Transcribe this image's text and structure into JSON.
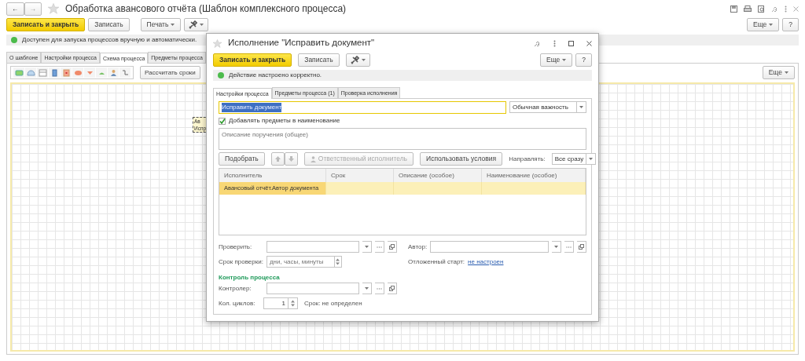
{
  "window": {
    "back": "←",
    "forward": "→",
    "title": "Обработка авансового отчёта (Шаблон комплексного процесса)",
    "buttons": [
      {
        "kind": "primary",
        "label": "Записать и закрыть"
      },
      {
        "kind": "plain",
        "label": "Записать"
      },
      {
        "kind": "menu",
        "label": "Печать"
      },
      {
        "kind": "tools"
      }
    ],
    "more": "Еще",
    "help": "?",
    "status": "Доступен для запуска процессов вручную и автоматически.",
    "tabs": [
      {
        "label": "О шаблоне",
        "selected": false
      },
      {
        "label": "Настройки процесса",
        "selected": false
      },
      {
        "label": "Схема процесса",
        "selected": true
      },
      {
        "label": "Предметы процесса",
        "selected": false
      }
    ],
    "schema_toolbar": {
      "calc": "Рассчитать сроки",
      "more": "Еще"
    },
    "node": {
      "lines": [
        "Ав",
        "Испр"
      ]
    }
  },
  "dialog": {
    "title": "Исполнение \"Исправить документ\"",
    "buttons": [
      {
        "kind": "primary",
        "label": "Записать и закрыть"
      },
      {
        "kind": "plain",
        "label": "Записать"
      },
      {
        "kind": "tools"
      }
    ],
    "more": "Еще",
    "help": "?",
    "status": "Действие настроено корректно.",
    "tabs": [
      {
        "label": "Настройки процесса",
        "selected": true
      },
      {
        "label": "Предметы процесса (1)",
        "selected": false
      },
      {
        "label": "Проверка исполнения",
        "selected": false
      }
    ],
    "name": "Исправить документ",
    "importance": "Обычная важность",
    "add_subjects": {
      "label": "Добавлять предметы в наименование",
      "checked": true
    },
    "description": {
      "placeholder": "Описание поручения (общее)"
    },
    "actions": [
      {
        "kind": "button",
        "label": "Подобрать",
        "disabled": false
      },
      {
        "kind": "arrows",
        "disabled": true
      },
      {
        "kind": "person",
        "label": "Ответственный исполнитель",
        "disabled": true
      },
      {
        "kind": "button",
        "label": "Использовать условия",
        "disabled": false
      }
    ],
    "route": {
      "label": "Направлять:",
      "value": "Все сразу"
    },
    "table": {
      "columns": [
        "Исполнитель",
        "Срок",
        "Описание (особое)",
        "Наименование (особое)"
      ],
      "rows": [
        {
          "cells": [
            "Авансовый отчёт.Автор документа"
          ],
          "selected": true
        }
      ]
    },
    "check": {
      "label": "Проверить:"
    },
    "author": {
      "label": "Автор:"
    },
    "check_term": {
      "label": "Срок проверки:",
      "placeholder": "дни, часы, минуты"
    },
    "delayed": {
      "label": "Отложенный старт:",
      "link": "не настроен"
    },
    "control_header": "Контроль процесса",
    "controller": {
      "label": "Контролер:"
    },
    "cycles": {
      "label": "Кол. циклов:",
      "value": "1",
      "term": "Срок: не определен"
    }
  }
}
